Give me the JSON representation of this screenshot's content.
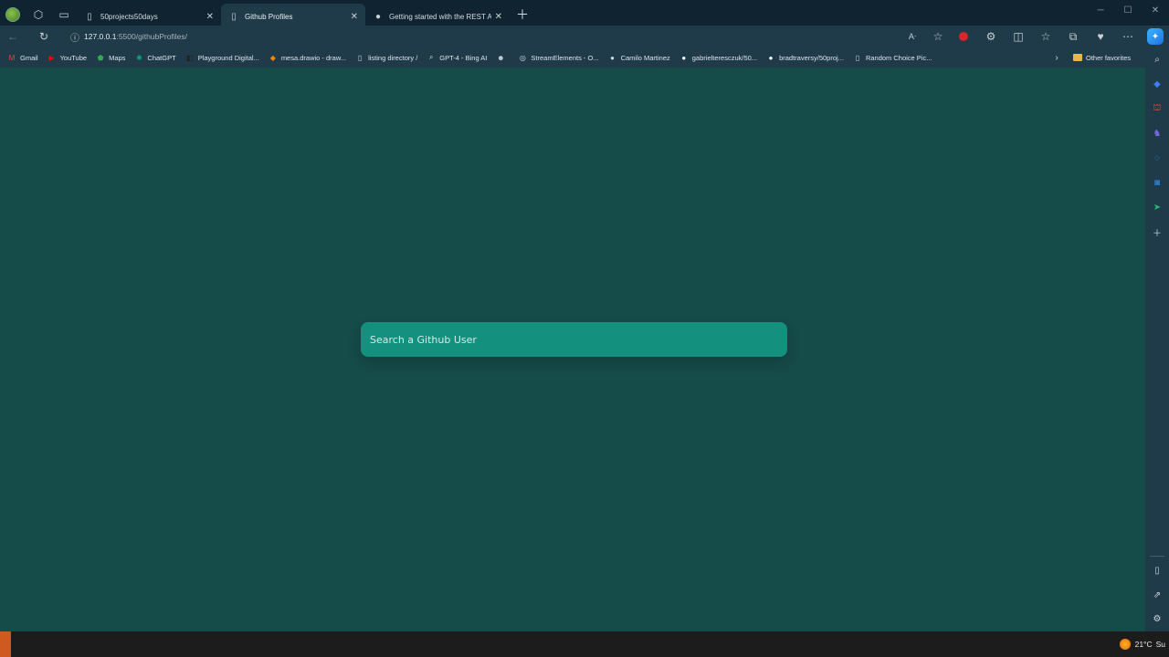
{
  "tabs": [
    {
      "title": "50projects50days",
      "icon": "page-icon",
      "active": false
    },
    {
      "title": "Github Profiles",
      "icon": "page-icon",
      "active": true
    },
    {
      "title": "Getting started with the REST AP",
      "icon": "github-icon",
      "active": false
    }
  ],
  "address_bar": {
    "url_host": "127.0.0.1",
    "url_rest": ":5500/githubProfiles/"
  },
  "bookmarks": [
    {
      "label": "Gmail",
      "icon": "gmail-icon",
      "color": "#ea4335"
    },
    {
      "label": "YouTube",
      "icon": "youtube-icon",
      "color": "#ff0000"
    },
    {
      "label": "Maps",
      "icon": "maps-icon",
      "color": "#34a853"
    },
    {
      "label": "ChatGPT",
      "icon": "chatgpt-icon",
      "color": "#10a37f"
    },
    {
      "label": "Playground Digital...",
      "icon": "playground-icon",
      "color": "#222222"
    },
    {
      "label": "mesa.drawio - draw...",
      "icon": "drawio-icon",
      "color": "#f08705"
    },
    {
      "label": "listing directory /",
      "icon": "page-icon",
      "color": "#cfd7db"
    },
    {
      "label": "GPT-4 - Bing AI",
      "icon": "search-icon",
      "color": "#cfd7db"
    },
    {
      "label": "",
      "icon": "robot-icon",
      "color": "#cfd7db"
    },
    {
      "label": "StreamElements - O...",
      "icon": "streamelements-icon",
      "color": "#cfd7db"
    },
    {
      "label": "Camilo Martinez",
      "icon": "person-icon",
      "color": "#cfd7db"
    },
    {
      "label": "gabrielteresczuk/50...",
      "icon": "github-icon",
      "color": "#ffffff"
    },
    {
      "label": "bradtraversy/50proj...",
      "icon": "github-icon",
      "color": "#ffffff"
    },
    {
      "label": "Random Choice Pic...",
      "icon": "page-icon",
      "color": "#cfd7db"
    }
  ],
  "other_favorites": "Other favorites",
  "search": {
    "placeholder": "Search a Github User"
  },
  "taskbar": {
    "weather": "21°C",
    "weather_extra": "Su"
  },
  "colors": {
    "page_background": "#154b49",
    "search_background": "#14907e",
    "browser_chrome": "#1f3a48"
  }
}
